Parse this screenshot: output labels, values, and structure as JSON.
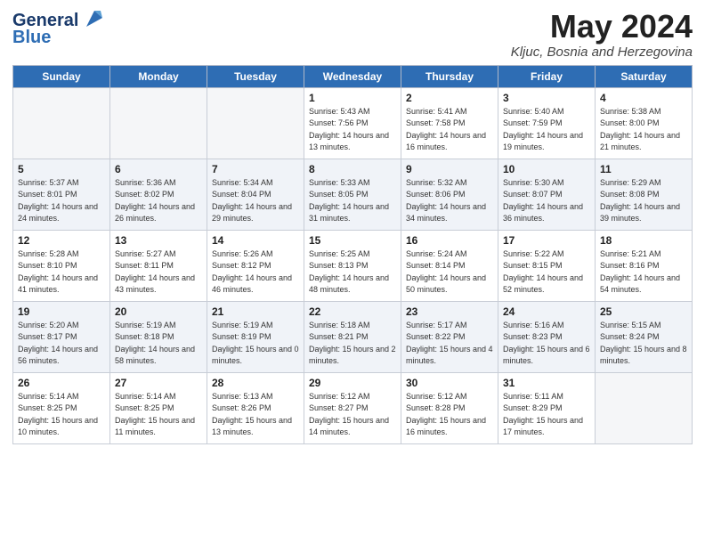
{
  "logo": {
    "line1": "General",
    "line2": "Blue"
  },
  "title": "May 2024",
  "location": "Kljuc, Bosnia and Herzegovina",
  "weekdays": [
    "Sunday",
    "Monday",
    "Tuesday",
    "Wednesday",
    "Thursday",
    "Friday",
    "Saturday"
  ],
  "weeks": [
    [
      {
        "day": "",
        "sunrise": "",
        "sunset": "",
        "daylight": ""
      },
      {
        "day": "",
        "sunrise": "",
        "sunset": "",
        "daylight": ""
      },
      {
        "day": "",
        "sunrise": "",
        "sunset": "",
        "daylight": ""
      },
      {
        "day": "1",
        "sunrise": "Sunrise: 5:43 AM",
        "sunset": "Sunset: 7:56 PM",
        "daylight": "Daylight: 14 hours and 13 minutes."
      },
      {
        "day": "2",
        "sunrise": "Sunrise: 5:41 AM",
        "sunset": "Sunset: 7:58 PM",
        "daylight": "Daylight: 14 hours and 16 minutes."
      },
      {
        "day": "3",
        "sunrise": "Sunrise: 5:40 AM",
        "sunset": "Sunset: 7:59 PM",
        "daylight": "Daylight: 14 hours and 19 minutes."
      },
      {
        "day": "4",
        "sunrise": "Sunrise: 5:38 AM",
        "sunset": "Sunset: 8:00 PM",
        "daylight": "Daylight: 14 hours and 21 minutes."
      }
    ],
    [
      {
        "day": "5",
        "sunrise": "Sunrise: 5:37 AM",
        "sunset": "Sunset: 8:01 PM",
        "daylight": "Daylight: 14 hours and 24 minutes."
      },
      {
        "day": "6",
        "sunrise": "Sunrise: 5:36 AM",
        "sunset": "Sunset: 8:02 PM",
        "daylight": "Daylight: 14 hours and 26 minutes."
      },
      {
        "day": "7",
        "sunrise": "Sunrise: 5:34 AM",
        "sunset": "Sunset: 8:04 PM",
        "daylight": "Daylight: 14 hours and 29 minutes."
      },
      {
        "day": "8",
        "sunrise": "Sunrise: 5:33 AM",
        "sunset": "Sunset: 8:05 PM",
        "daylight": "Daylight: 14 hours and 31 minutes."
      },
      {
        "day": "9",
        "sunrise": "Sunrise: 5:32 AM",
        "sunset": "Sunset: 8:06 PM",
        "daylight": "Daylight: 14 hours and 34 minutes."
      },
      {
        "day": "10",
        "sunrise": "Sunrise: 5:30 AM",
        "sunset": "Sunset: 8:07 PM",
        "daylight": "Daylight: 14 hours and 36 minutes."
      },
      {
        "day": "11",
        "sunrise": "Sunrise: 5:29 AM",
        "sunset": "Sunset: 8:08 PM",
        "daylight": "Daylight: 14 hours and 39 minutes."
      }
    ],
    [
      {
        "day": "12",
        "sunrise": "Sunrise: 5:28 AM",
        "sunset": "Sunset: 8:10 PM",
        "daylight": "Daylight: 14 hours and 41 minutes."
      },
      {
        "day": "13",
        "sunrise": "Sunrise: 5:27 AM",
        "sunset": "Sunset: 8:11 PM",
        "daylight": "Daylight: 14 hours and 43 minutes."
      },
      {
        "day": "14",
        "sunrise": "Sunrise: 5:26 AM",
        "sunset": "Sunset: 8:12 PM",
        "daylight": "Daylight: 14 hours and 46 minutes."
      },
      {
        "day": "15",
        "sunrise": "Sunrise: 5:25 AM",
        "sunset": "Sunset: 8:13 PM",
        "daylight": "Daylight: 14 hours and 48 minutes."
      },
      {
        "day": "16",
        "sunrise": "Sunrise: 5:24 AM",
        "sunset": "Sunset: 8:14 PM",
        "daylight": "Daylight: 14 hours and 50 minutes."
      },
      {
        "day": "17",
        "sunrise": "Sunrise: 5:22 AM",
        "sunset": "Sunset: 8:15 PM",
        "daylight": "Daylight: 14 hours and 52 minutes."
      },
      {
        "day": "18",
        "sunrise": "Sunrise: 5:21 AM",
        "sunset": "Sunset: 8:16 PM",
        "daylight": "Daylight: 14 hours and 54 minutes."
      }
    ],
    [
      {
        "day": "19",
        "sunrise": "Sunrise: 5:20 AM",
        "sunset": "Sunset: 8:17 PM",
        "daylight": "Daylight: 14 hours and 56 minutes."
      },
      {
        "day": "20",
        "sunrise": "Sunrise: 5:19 AM",
        "sunset": "Sunset: 8:18 PM",
        "daylight": "Daylight: 14 hours and 58 minutes."
      },
      {
        "day": "21",
        "sunrise": "Sunrise: 5:19 AM",
        "sunset": "Sunset: 8:19 PM",
        "daylight": "Daylight: 15 hours and 0 minutes."
      },
      {
        "day": "22",
        "sunrise": "Sunrise: 5:18 AM",
        "sunset": "Sunset: 8:21 PM",
        "daylight": "Daylight: 15 hours and 2 minutes."
      },
      {
        "day": "23",
        "sunrise": "Sunrise: 5:17 AM",
        "sunset": "Sunset: 8:22 PM",
        "daylight": "Daylight: 15 hours and 4 minutes."
      },
      {
        "day": "24",
        "sunrise": "Sunrise: 5:16 AM",
        "sunset": "Sunset: 8:23 PM",
        "daylight": "Daylight: 15 hours and 6 minutes."
      },
      {
        "day": "25",
        "sunrise": "Sunrise: 5:15 AM",
        "sunset": "Sunset: 8:24 PM",
        "daylight": "Daylight: 15 hours and 8 minutes."
      }
    ],
    [
      {
        "day": "26",
        "sunrise": "Sunrise: 5:14 AM",
        "sunset": "Sunset: 8:25 PM",
        "daylight": "Daylight: 15 hours and 10 minutes."
      },
      {
        "day": "27",
        "sunrise": "Sunrise: 5:14 AM",
        "sunset": "Sunset: 8:25 PM",
        "daylight": "Daylight: 15 hours and 11 minutes."
      },
      {
        "day": "28",
        "sunrise": "Sunrise: 5:13 AM",
        "sunset": "Sunset: 8:26 PM",
        "daylight": "Daylight: 15 hours and 13 minutes."
      },
      {
        "day": "29",
        "sunrise": "Sunrise: 5:12 AM",
        "sunset": "Sunset: 8:27 PM",
        "daylight": "Daylight: 15 hours and 14 minutes."
      },
      {
        "day": "30",
        "sunrise": "Sunrise: 5:12 AM",
        "sunset": "Sunset: 8:28 PM",
        "daylight": "Daylight: 15 hours and 16 minutes."
      },
      {
        "day": "31",
        "sunrise": "Sunrise: 5:11 AM",
        "sunset": "Sunset: 8:29 PM",
        "daylight": "Daylight: 15 hours and 17 minutes."
      },
      {
        "day": "",
        "sunrise": "",
        "sunset": "",
        "daylight": ""
      }
    ]
  ]
}
